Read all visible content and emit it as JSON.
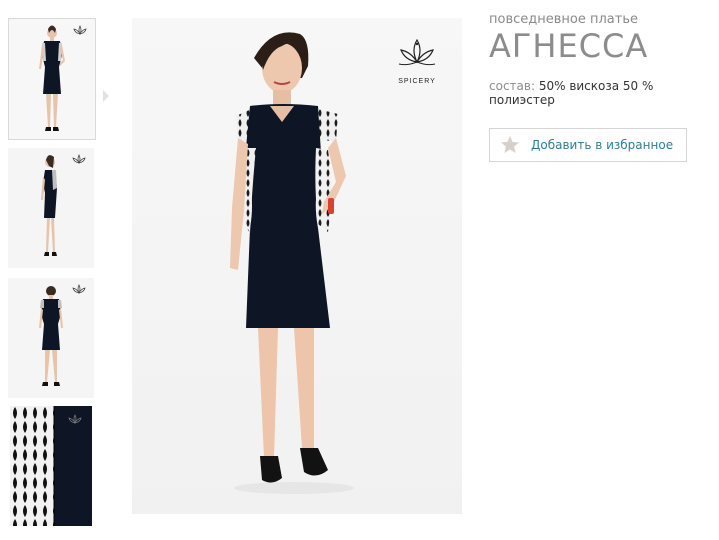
{
  "product": {
    "subtitle": "повседневное платье",
    "title": "АГНЕССА",
    "composition_label": "состав:",
    "composition_value": "50% вискоза 50 % полиэстер"
  },
  "actions": {
    "add_to_favorites": "Добавить в избранное"
  },
  "brand": {
    "name": "SPICERY"
  },
  "thumbnails": [
    {
      "view": "front",
      "active": true
    },
    {
      "view": "side",
      "active": false
    },
    {
      "view": "back",
      "active": false
    },
    {
      "view": "fabric-closeup",
      "active": false
    }
  ],
  "colors": {
    "dress": "#0e1626",
    "accent_link": "#2e7d99",
    "star_icon": "#d7cfc8",
    "muted_text": "#8c8c8c"
  }
}
